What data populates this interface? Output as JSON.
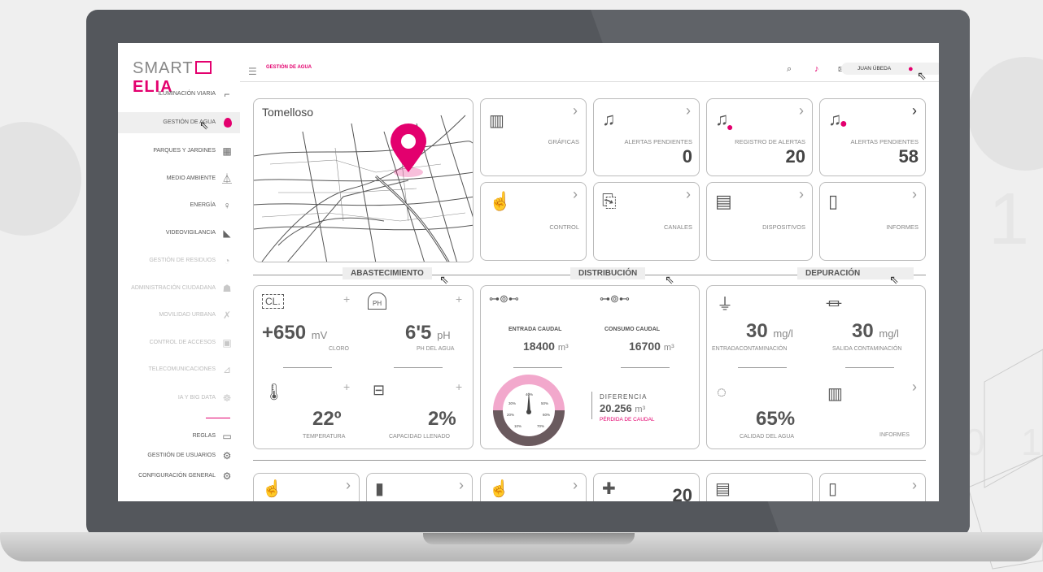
{
  "app": {
    "logo_light": "SMART",
    "logo_bold": "ELIA",
    "page_title": "GESTIÓN DE AGUA",
    "user_name": "JUAN ÚBEDA"
  },
  "sidebar": {
    "items": [
      {
        "label": "ILUMINACIÓN VIARIA",
        "icon": "streetlight-icon",
        "active": false,
        "dim": false
      },
      {
        "label": "GESTIÓN DE AGUA",
        "icon": "water-drop-icon",
        "active": true,
        "dim": false
      },
      {
        "label": "PARQUES Y JARDINES",
        "icon": "park-icon",
        "active": false,
        "dim": false
      },
      {
        "label": "MEDIO AMBIENTE",
        "icon": "plant-icon",
        "active": false,
        "dim": false
      },
      {
        "label": "ENERGÍA",
        "icon": "bulb-icon",
        "active": false,
        "dim": false
      },
      {
        "label": "VIDEOVIGILANCIA",
        "icon": "camera-icon",
        "active": false,
        "dim": false
      },
      {
        "label": "GESTIÓN DE RESIDUOS",
        "icon": "recycle-icon",
        "active": false,
        "dim": true
      },
      {
        "label": "ADMINISTRACIÓN CIUDADANA",
        "icon": "people-icon",
        "active": false,
        "dim": true
      },
      {
        "label": "MOVILIDAD URBANA",
        "icon": "walking-icon",
        "active": false,
        "dim": true
      },
      {
        "label": "CONTROL DE ACCESOS",
        "icon": "access-icon",
        "active": false,
        "dim": true
      },
      {
        "label": "TELECOMUNICACIONES",
        "icon": "antenna-icon",
        "active": false,
        "dim": true
      },
      {
        "label": "IA Y BIG DATA",
        "icon": "robot-icon",
        "active": false,
        "dim": true
      }
    ],
    "bottom_items": [
      {
        "label": "REGLAS",
        "icon": "terminal-icon"
      },
      {
        "label": "GESTIIÓN DE USUARIOS",
        "icon": "user-gear-icon"
      },
      {
        "label": "CONFIGURACIÓN GENERAL",
        "icon": "settings-icon"
      }
    ]
  },
  "map": {
    "city": "Tomelloso"
  },
  "tiles": {
    "graficas": {
      "label": "GRÁFICAS"
    },
    "alertas1": {
      "label": "ALERTAS PENDIENTES",
      "value": "0"
    },
    "registro": {
      "label": "REGISTRO DE ALERTAS",
      "value": "20"
    },
    "alertas2": {
      "label": "ALERTAS PENDIENTES",
      "value": "58"
    },
    "control": {
      "label": "CONTROL"
    },
    "canales": {
      "label": "CANALES"
    },
    "dispositivos": {
      "label": "DISPOSITIVOS"
    },
    "informes": {
      "label": "INFORMES"
    }
  },
  "sections": {
    "abastecimiento": "ABASTECIMIENTO",
    "distribucion": "DISTRIBUCIÓN",
    "depuracion": "DEPURACIÓN"
  },
  "abastecimiento": {
    "cloro_value": "+650",
    "cloro_unit": "mV",
    "cloro_label": "CLORO",
    "ph_value": "6'5",
    "ph_unit": "pH",
    "ph_label": "pH DEL AGUA",
    "temp_value": "22º",
    "temp_label": "TEMPERATURA",
    "capacity_value": "2%",
    "capacity_label": "CAPACIDAD LLENADO",
    "cloro_icon_text": "CL.",
    "ph_icon_text": "PH"
  },
  "distribucion": {
    "entrada_label": "ENTRADA CAUDAL",
    "entrada_value": "18400",
    "consumo_label": "CONSUMO CAUDAL",
    "consumo_value": "16700",
    "unit": "m³",
    "diferencia_label": "DIFERENCIA",
    "diferencia_value": "20.256",
    "perdida_label": "PÉRDIDA DE CAUDAL",
    "gauge_ticks": [
      "10%",
      "20%",
      "30%",
      "40%",
      "50%",
      "60%",
      "70%"
    ]
  },
  "depuracion": {
    "entrada_value": "30",
    "entrada_unit": "mg/l",
    "entrada_label": "ENTRADACONTAMINACIÓN",
    "salida_value": "30",
    "salida_unit": "mg/l",
    "salida_label": "SALIDA CONTAMINACIÓN",
    "calidad_value": "65%",
    "calidad_label": "CALIDAD DEL AGUA",
    "informes_label": "INFORMES"
  },
  "bottom_row": {
    "value": "20"
  },
  "background": {
    "digits": [
      "1",
      "0",
      "1",
      "0"
    ]
  }
}
